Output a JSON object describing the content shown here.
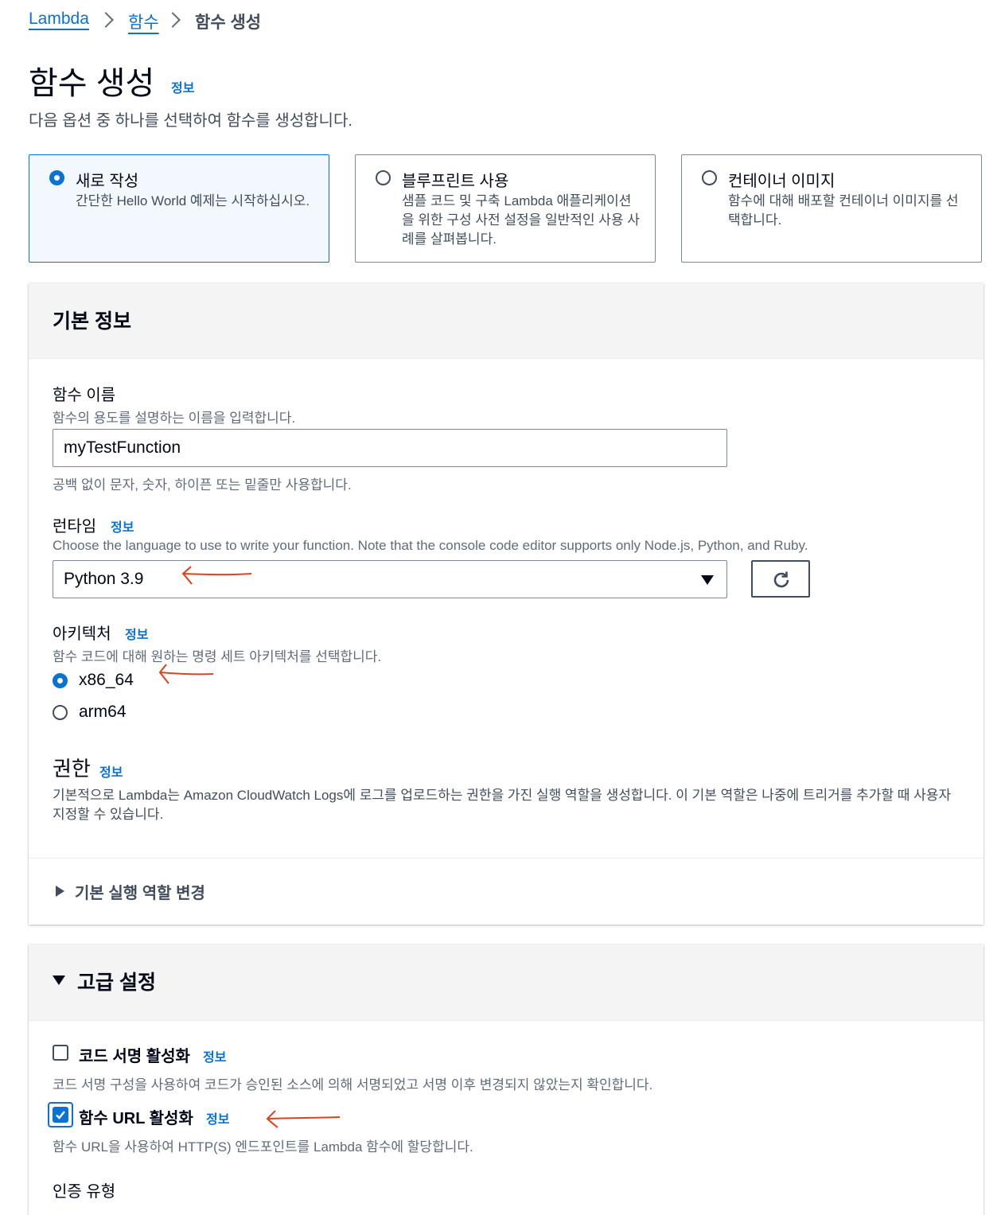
{
  "breadcrumb": {
    "root": "Lambda",
    "parent": "함수",
    "current": "함수 생성"
  },
  "header": {
    "title": "함수 생성",
    "info": "정보",
    "subtitle": "다음 옵션 중 하나를 선택하여 함수를 생성합니다."
  },
  "options": [
    {
      "title": "새로 작성",
      "desc": "간단한 Hello World 예제는 시작하십시오.",
      "selected": true
    },
    {
      "title": "블루프린트 사용",
      "desc": "샘플 코드 및 구축 Lambda 애플리케이션을 위한 구성 사전 설정을 일반적인 사용 사례를 살펴봅니다.",
      "selected": false
    },
    {
      "title": "컨테이너 이미지",
      "desc": "함수에 대해 배포할 컨테이너 이미지를 선택합니다.",
      "selected": false
    }
  ],
  "basic": {
    "title": "기본 정보",
    "function_name": {
      "label": "함수 이름",
      "desc": "함수의 용도를 설명하는 이름을 입력합니다.",
      "value": "myTestFunction",
      "hint": "공백 없이 문자, 숫자, 하이픈 또는 밑줄만 사용합니다."
    },
    "runtime": {
      "label": "런타임",
      "info": "정보",
      "desc": "Choose the language to use to write your function. Note that the console code editor supports only Node.js, Python, and Ruby.",
      "value": "Python 3.9"
    },
    "architecture": {
      "label": "아키텍처",
      "info": "정보",
      "desc": "함수 코드에 대해 원하는 명령 세트 아키텍처를 선택합니다.",
      "options": [
        "x86_64",
        "arm64"
      ],
      "selected": "x86_64"
    },
    "permissions": {
      "label": "권한",
      "info": "정보",
      "desc": "기본적으로 Lambda는 Amazon CloudWatch Logs에 로그를 업로드하는 권한을 가진 실행 역할을 생성합니다. 이 기본 역할은 나중에 트리거를 추가할 때 사용자 지정할 수 있습니다."
    },
    "role_toggle": "기본 실행 역할 변경"
  },
  "advanced": {
    "title": "고급 설정",
    "code_signing": {
      "label": "코드 서명 활성화",
      "info": "정보",
      "desc": "코드 서명 구성을 사용하여 코드가 승인된 소스에 의해 서명되었고 서명 이후 변경되지 않았는지 확인합니다.",
      "checked": false
    },
    "function_url": {
      "label": "함수 URL 활성화",
      "info": "정보",
      "desc": "함수 URL을 사용하여 HTTP(S) 엔드포인트를 Lambda 함수에 할당합니다.",
      "checked": true
    },
    "auth_type_label": "인증 유형"
  },
  "colors": {
    "accent": "#0972d3",
    "annotation": "#e0401c",
    "text": "#000716",
    "muted": "#5f6b7a"
  },
  "icons": {
    "refresh": "refresh-icon",
    "dropdown": "caret-down-icon",
    "expand": "caret-right-icon",
    "collapse": "caret-down-icon"
  }
}
